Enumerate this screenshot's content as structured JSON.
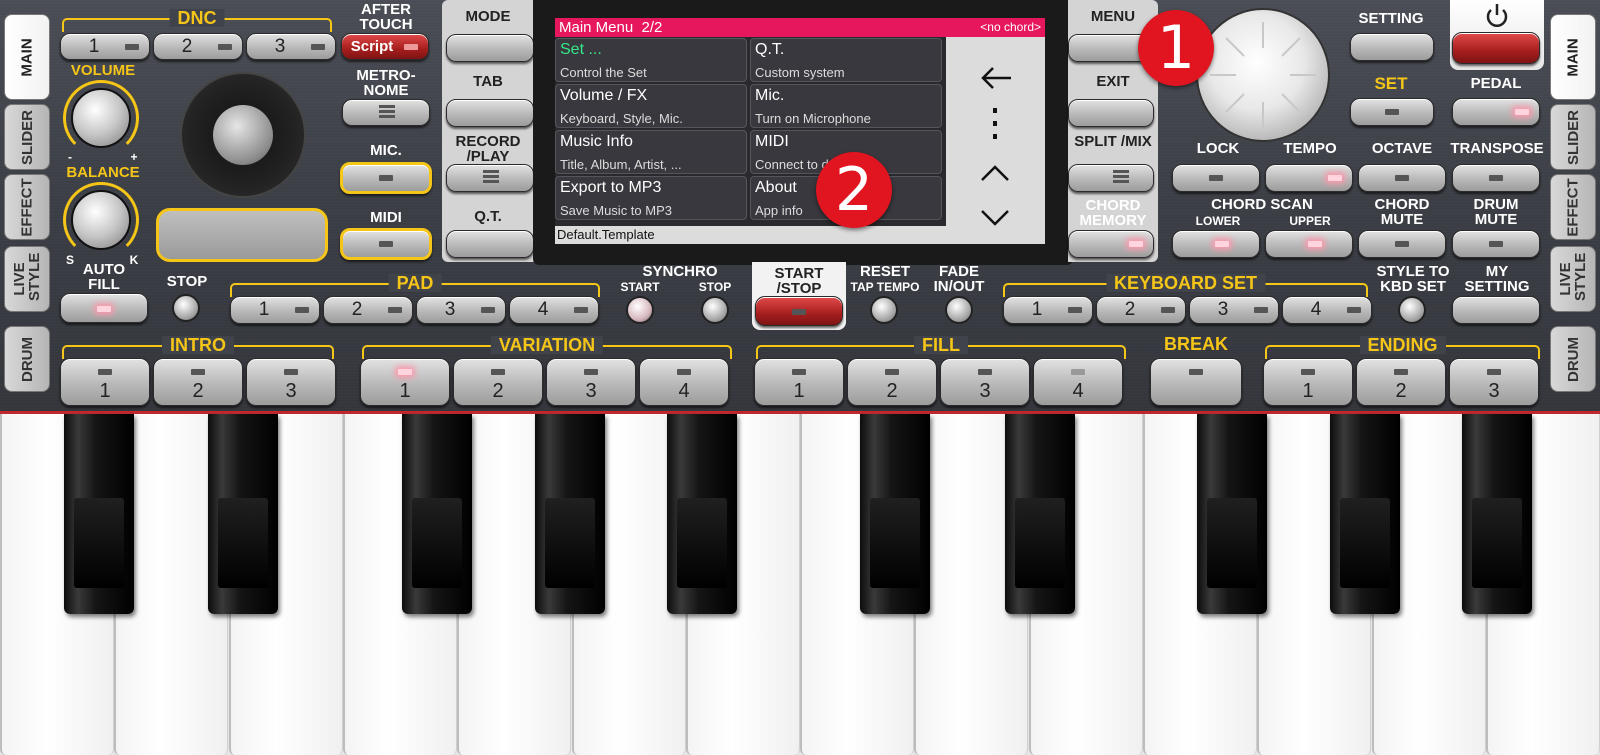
{
  "side_tabs_left": [
    "MAIN",
    "SLIDER",
    "EFFECT",
    "LIVE STYLE",
    "DRUM"
  ],
  "side_tabs_right": [
    "MAIN",
    "SLIDER",
    "EFFECT",
    "LIVE STYLE",
    "DRUM"
  ],
  "dnc": {
    "label": "DNC",
    "buttons": [
      "1",
      "2",
      "3"
    ],
    "script": "Script"
  },
  "after_touch": "AFTER TOUCH",
  "volume": "VOLUME",
  "balance": {
    "label": "BALANCE",
    "minus": "-",
    "plus": "+",
    "s": "S",
    "k": "K"
  },
  "auto_fill": "AUTO FILL",
  "metronome": "METRO- NOME",
  "mic": "MIC.",
  "midi": "MIDI",
  "stop": "STOP",
  "pad": {
    "label": "PAD",
    "buttons": [
      "1",
      "2",
      "3",
      "4"
    ]
  },
  "synchro": {
    "label": "SYNCHRO",
    "start": "START",
    "stop": "STOP"
  },
  "start_stop": "START /STOP",
  "reset": {
    "label": "RESET",
    "sub": "TAP TEMPO"
  },
  "fade": "FADE IN/OUT",
  "keyboard_set": {
    "label": "KEYBOARD SET",
    "buttons": [
      "1",
      "2",
      "3",
      "4"
    ]
  },
  "style_to_kbd": "STYLE TO KBD SET",
  "my_setting": "MY SETTING",
  "intro": {
    "label": "INTRO",
    "buttons": [
      "1",
      "2",
      "3"
    ]
  },
  "variation": {
    "label": "VARIATION",
    "buttons": [
      "1",
      "2",
      "3",
      "4"
    ]
  },
  "fill": {
    "label": "FILL",
    "buttons": [
      "1",
      "2",
      "3",
      "4"
    ]
  },
  "break": "BREAK",
  "ending": {
    "label": "ENDING",
    "buttons": [
      "1",
      "2",
      "3"
    ]
  },
  "left_cluster": {
    "mode": "MODE",
    "tab": "TAB",
    "record": "RECORD /PLAY",
    "qt": "Q.T."
  },
  "right_cluster": {
    "menu": "MENU",
    "exit": "EXIT",
    "split": "SPLIT /MIX",
    "chord_memory": "CHORD MEMORY"
  },
  "setting": "SETTING",
  "set": "SET",
  "pedal": "PEDAL",
  "lock": "LOCK",
  "tempo": "TEMPO",
  "octave": "OCTAVE",
  "transpose": "TRANSPOSE",
  "chord_scan": {
    "label": "CHORD SCAN",
    "lower": "LOWER",
    "upper": "UPPER"
  },
  "chord_mute": "CHORD MUTE",
  "drum_mute": "DRUM MUTE",
  "lcd": {
    "title": "Main Menu  2/2",
    "chord": "<no chord>",
    "items": [
      {
        "title": "Set ...",
        "sub": "Control the Set"
      },
      {
        "title": "Q.T.",
        "sub": "Custom system"
      },
      {
        "title": "Volume / FX",
        "sub": "Keyboard, Style, Mic."
      },
      {
        "title": "Mic.",
        "sub": "Turn on Microphone"
      },
      {
        "title": "Music Info",
        "sub": "Title, Album, Artist, ..."
      },
      {
        "title": "MIDI",
        "sub": "Connect to devices"
      },
      {
        "title": "Export to MP3",
        "sub": "Save Music to MP3"
      },
      {
        "title": "About",
        "sub": "App info"
      }
    ],
    "footer": "Default.Template"
  },
  "badges": [
    "1",
    "2"
  ],
  "icons": {
    "back": "arrow-left-icon",
    "more": "more-vert-icon",
    "up": "chevron-up-icon",
    "down": "chevron-down-icon",
    "power": "power-icon"
  }
}
